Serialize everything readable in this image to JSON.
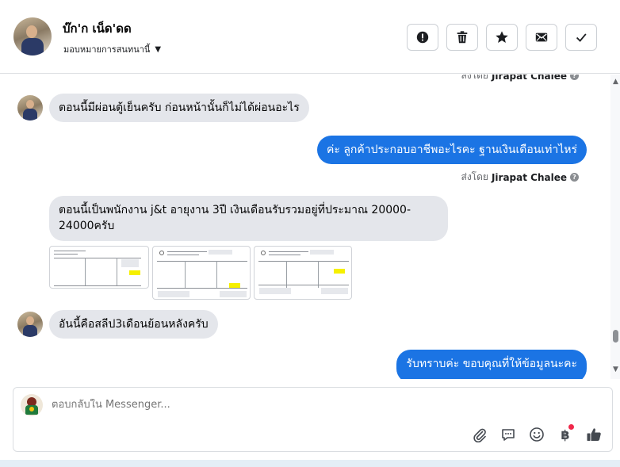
{
  "header": {
    "contact_name": "บ๊ก'ก เน็ด'ดด",
    "assign_label": "มอบหมายการสนทนานี้",
    "actions": [
      {
        "name": "spam-button",
        "icon": "alert-circle-icon"
      },
      {
        "name": "delete-button",
        "icon": "trash-icon"
      },
      {
        "name": "star-button",
        "icon": "star-icon"
      },
      {
        "name": "mark-unread-button",
        "icon": "envelope-icon"
      },
      {
        "name": "mark-done-button",
        "icon": "check-icon"
      }
    ]
  },
  "thread": {
    "sent_by_prefix": "ส่งโดย",
    "sent_by_agent": "Jirapat Chalee",
    "messages": {
      "m1": "ตอนนี้มีผ่อนตู้เย็นครับ ก่อนหน้านั้นก็ไม่ได้ผ่อนอะไร",
      "m2": "ค่ะ ลูกค้าประกอบอาชีพอะไรคะ ฐานเงินเดือนเท่าไหร่",
      "m3": "ตอนนี้เป็นพนักงาน j&t อายุงาน 3ปี เงินเดือนรับรวมอยู่ที่ประมาณ 20000-24000ครับ",
      "m4": "อันนี้คือสลีป3เดือนย้อนหลังครับ",
      "m5": "รับทราบค่ะ ขอบคุณที่ให้ข้อมูลนะคะ"
    }
  },
  "composer": {
    "placeholder": "ตอบกลับใน Messenger...",
    "currency_symbol": "฿"
  },
  "colors": {
    "outgoing_bubble": "#1b74e4",
    "incoming_bubble": "#e4e6eb",
    "notification_dot": "#f0284a"
  }
}
